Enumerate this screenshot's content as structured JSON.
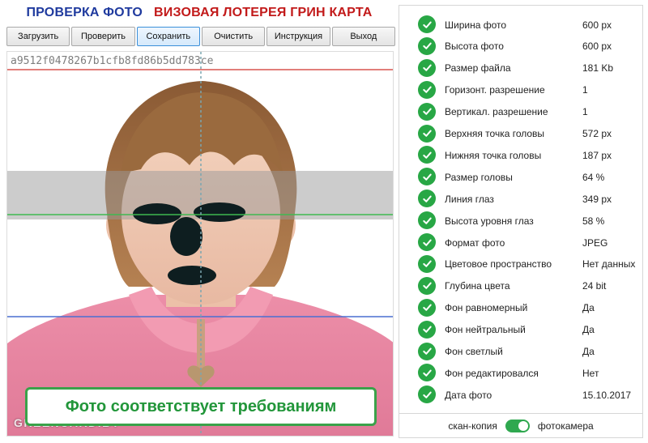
{
  "header": {
    "title_left": "ПРОВЕРКА ФОТО",
    "title_right": "ВИЗОВАЯ ЛОТЕРЕЯ ГРИН КАРТА"
  },
  "toolbar": {
    "buttons": [
      "Загрузить",
      "Проверить",
      "Сохранить",
      "Очистить",
      "Инструкция",
      "Выход"
    ],
    "active_button": "Сохранить"
  },
  "photo": {
    "hash": "a9512f0478267b1cfb8fd86b5dd783ce",
    "watermark": "GREENCARD.BY",
    "result_text": "Фото соответствует требованиям"
  },
  "checks": [
    {
      "label": "Ширина фото",
      "value": "600 px"
    },
    {
      "label": "Высота фото",
      "value": "600 px"
    },
    {
      "label": "Размер файла",
      "value": "181 Kb"
    },
    {
      "label": "Горизонт. разрешение",
      "value": "1"
    },
    {
      "label": "Вертикал. разрешение",
      "value": "1"
    },
    {
      "label": "Верхняя точка головы",
      "value": "572 px"
    },
    {
      "label": "Нижняя точка головы",
      "value": "187 px"
    },
    {
      "label": "Размер головы",
      "value": "64 %"
    },
    {
      "label": "Линия глаз",
      "value": "349 px"
    },
    {
      "label": "Высота уровня глаз",
      "value": "58 %"
    },
    {
      "label": "Формат фото",
      "value": "JPEG"
    },
    {
      "label": "Цветовое пространство",
      "value": "Нет данных"
    },
    {
      "label": "Глубина цвета",
      "value": "24 bit"
    },
    {
      "label": "Фон равномерный",
      "value": "Да"
    },
    {
      "label": "Фон нейтральный",
      "value": "Да"
    },
    {
      "label": "Фон светлый",
      "value": "Да"
    },
    {
      "label": "Фон редактировался",
      "value": "Нет"
    },
    {
      "label": "Дата фото",
      "value": "15.10.2017"
    }
  ],
  "source_toggle": {
    "left_label": "скан-копия",
    "right_label": "фотокамера",
    "state": "фотокамера"
  },
  "colors": {
    "title_blue": "#1f3a9e",
    "title_red": "#c21a1a",
    "check_green": "#28a745",
    "result_green": "#22963a",
    "guide_red": "#d9534f",
    "guide_green": "#3fb950",
    "guide_blue": "#4a6fd1",
    "guide_center": "#7aa6b0"
  }
}
